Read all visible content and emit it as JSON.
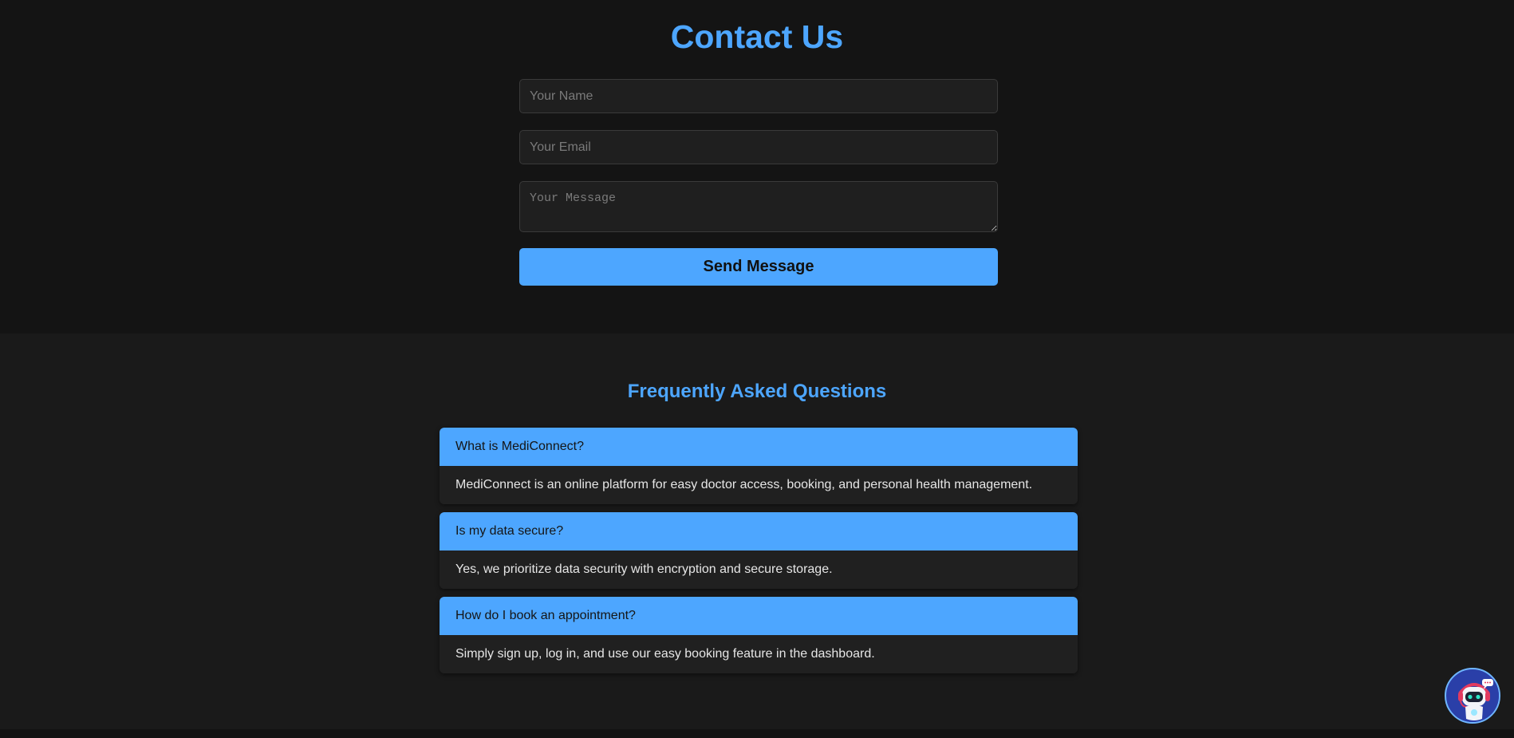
{
  "contact": {
    "title": "Contact Us",
    "name_placeholder": "Your Name",
    "email_placeholder": "Your Email",
    "message_placeholder": "Your Message",
    "send_label": "Send Message"
  },
  "faq": {
    "title": "Frequently Asked Questions",
    "items": [
      {
        "question": "What is MediConnect?",
        "answer": "MediConnect is an online platform for easy doctor access, booking, and personal health management."
      },
      {
        "question": "Is my data secure?",
        "answer": "Yes, we prioritize data security with encryption and secure storage."
      },
      {
        "question": "How do I book an appointment?",
        "answer": "Simply sign up, log in, and use our easy booking feature in the dashboard."
      }
    ]
  },
  "chatbot": {
    "icon": "robot-icon"
  },
  "colors": {
    "accent": "#4da6ff",
    "background": "#141414",
    "panel": "#202020"
  }
}
